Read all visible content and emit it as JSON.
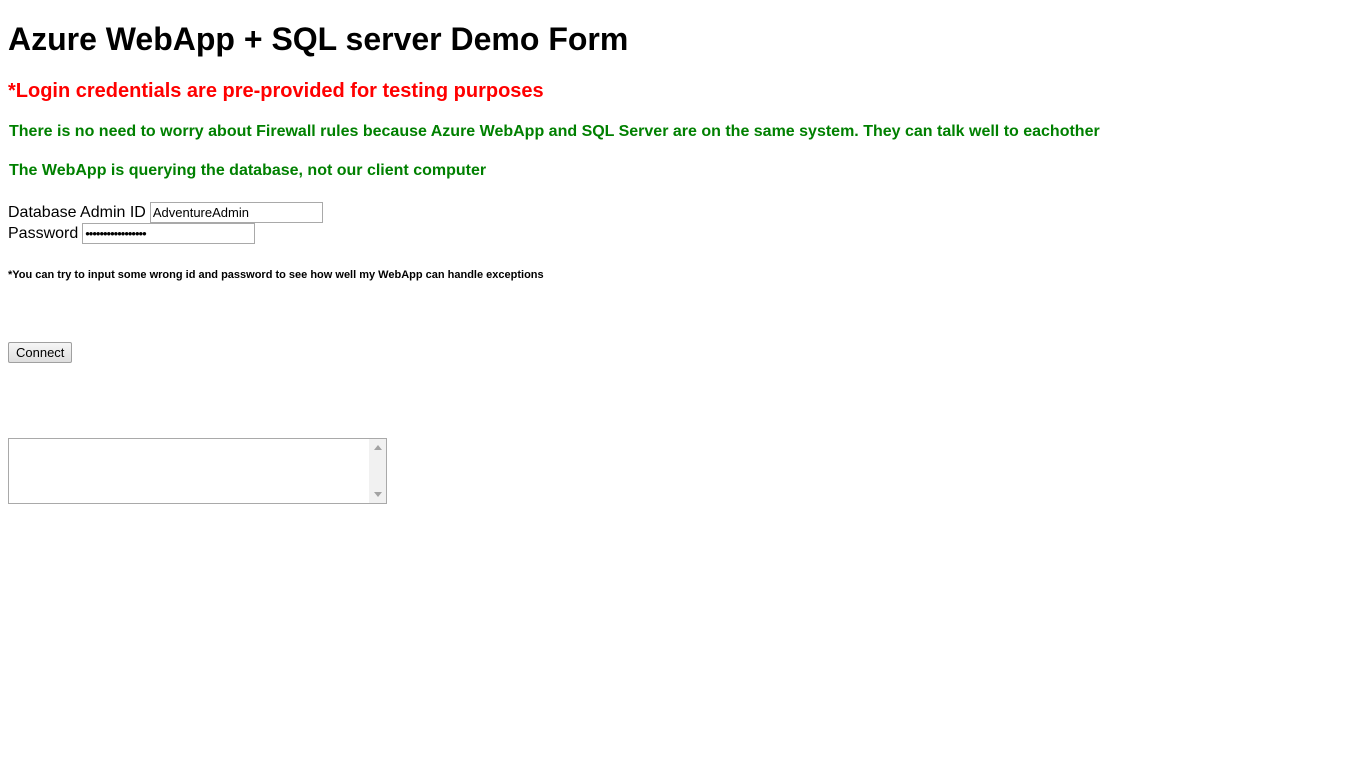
{
  "page": {
    "title": "Azure WebApp + SQL server Demo Form",
    "credentials_note": "*Login credentials are pre-provided for testing purposes",
    "firewall_note": "There is no need to worry about Firewall rules because Azure WebApp and SQL Server are on the same system. They can talk well to eachother",
    "query_note": "The WebApp is querying the database, not our client computer"
  },
  "form": {
    "admin_label": "Database Admin ID",
    "admin_value": "AdventureAdmin",
    "password_label": "Password",
    "password_value": "•••••••••••••••••",
    "hint": "*You can try to input some wrong id and password to see how well my WebApp can handle exceptions",
    "connect_label": "Connect",
    "output_value": ""
  },
  "colors": {
    "warning_red": "#ff0000",
    "info_green": "#008000"
  }
}
